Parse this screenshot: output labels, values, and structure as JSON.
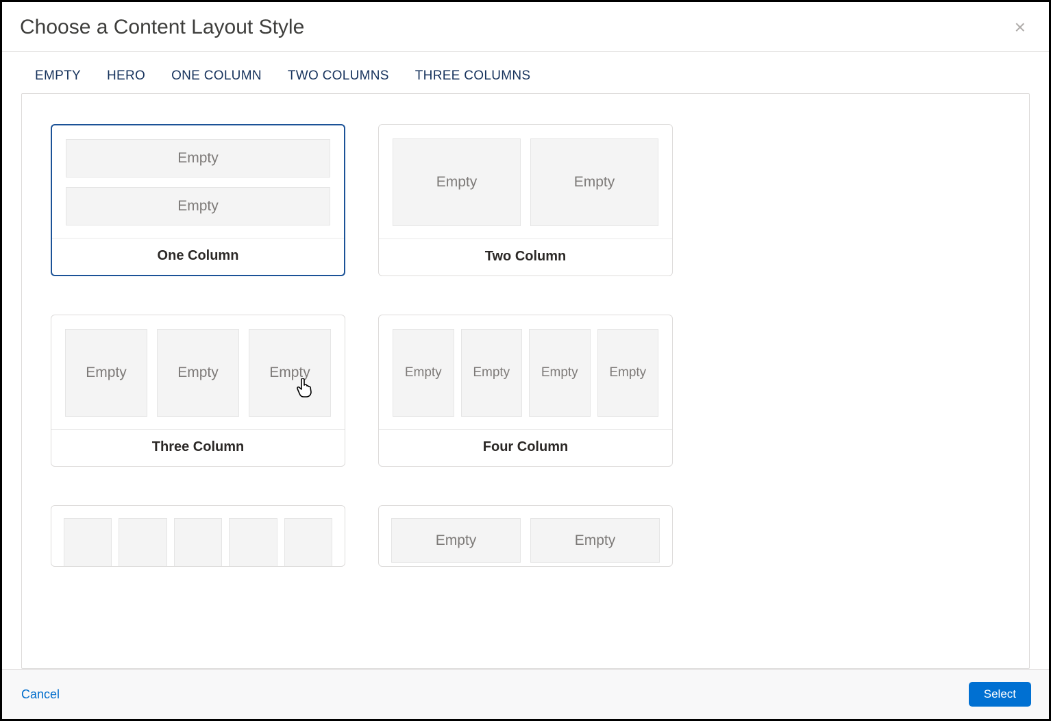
{
  "modal": {
    "title": "Choose a Content Layout Style"
  },
  "tabs": {
    "empty": "EMPTY",
    "hero": "HERO",
    "one_column": "ONE COLUMN",
    "two_columns": "TWO COLUMNS",
    "three_columns": "THREE COLUMNS"
  },
  "placeholder": "Empty",
  "cards": {
    "one_column": "One Column",
    "two_column": "Two Column",
    "three_column": "Three Column",
    "four_column": "Four Column"
  },
  "selected_card": "one_column",
  "footer": {
    "cancel": "Cancel",
    "select": "Select"
  }
}
